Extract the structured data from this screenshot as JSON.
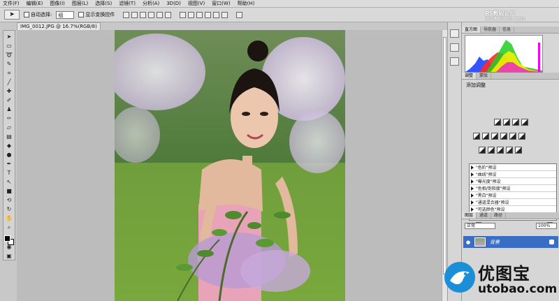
{
  "menubar": {
    "items": [
      "文件(F)",
      "编辑(E)",
      "图像(I)",
      "图层(L)",
      "选择(S)",
      "滤镜(T)",
      "分析(A)",
      "3D(D)",
      "视图(V)",
      "窗口(W)",
      "帮助(H)"
    ]
  },
  "options_bar": {
    "auto_select_label": "自动选择:",
    "auto_select_value": "组",
    "show_transform_label": "显示变换控件"
  },
  "document": {
    "tab_title": "IMG_0012.JPG @ 16.7%(RGB/8)"
  },
  "panels": {
    "histogram_tabs": [
      "直方图",
      "导航器",
      "信息"
    ],
    "adjust_tabs": [
      "调整",
      "蒙版"
    ],
    "adjust_title": "添加调整",
    "presets": [
      "\"色阶\"预设",
      "\"曲线\"预设",
      "\"曝光度\"预设",
      "\"色相/饱和度\"预设",
      "\"黑白\"预设",
      "\"通道混合器\"预设",
      "\"可选颜色\"预设"
    ],
    "layers_tabs": [
      "图层",
      "通道",
      "路径"
    ],
    "blend_mode": "正常",
    "opacity": "100%",
    "layer_name": "背景"
  },
  "watermarks": {
    "top_line1": "PS教程论坛",
    "top_line2": "BBS.16XX8.COM",
    "logo_cn": "优图宝",
    "logo_en": "utobao.com"
  },
  "colors": {
    "selected_layer": "#3a6ec4",
    "foreground": "#000000",
    "background": "#ffffff"
  },
  "icons": {
    "tools": [
      "move-icon",
      "marquee-icon",
      "lasso-icon",
      "quick-select-icon",
      "crop-icon",
      "eyedropper-icon",
      "healing-icon",
      "brush-icon",
      "clone-stamp-icon",
      "history-brush-icon",
      "eraser-icon",
      "gradient-icon",
      "blur-icon",
      "dodge-icon",
      "pen-icon",
      "type-icon",
      "path-select-icon",
      "shape-icon",
      "3d-rotate-icon",
      "3d-orbit-icon",
      "hand-icon",
      "zoom-icon"
    ]
  }
}
